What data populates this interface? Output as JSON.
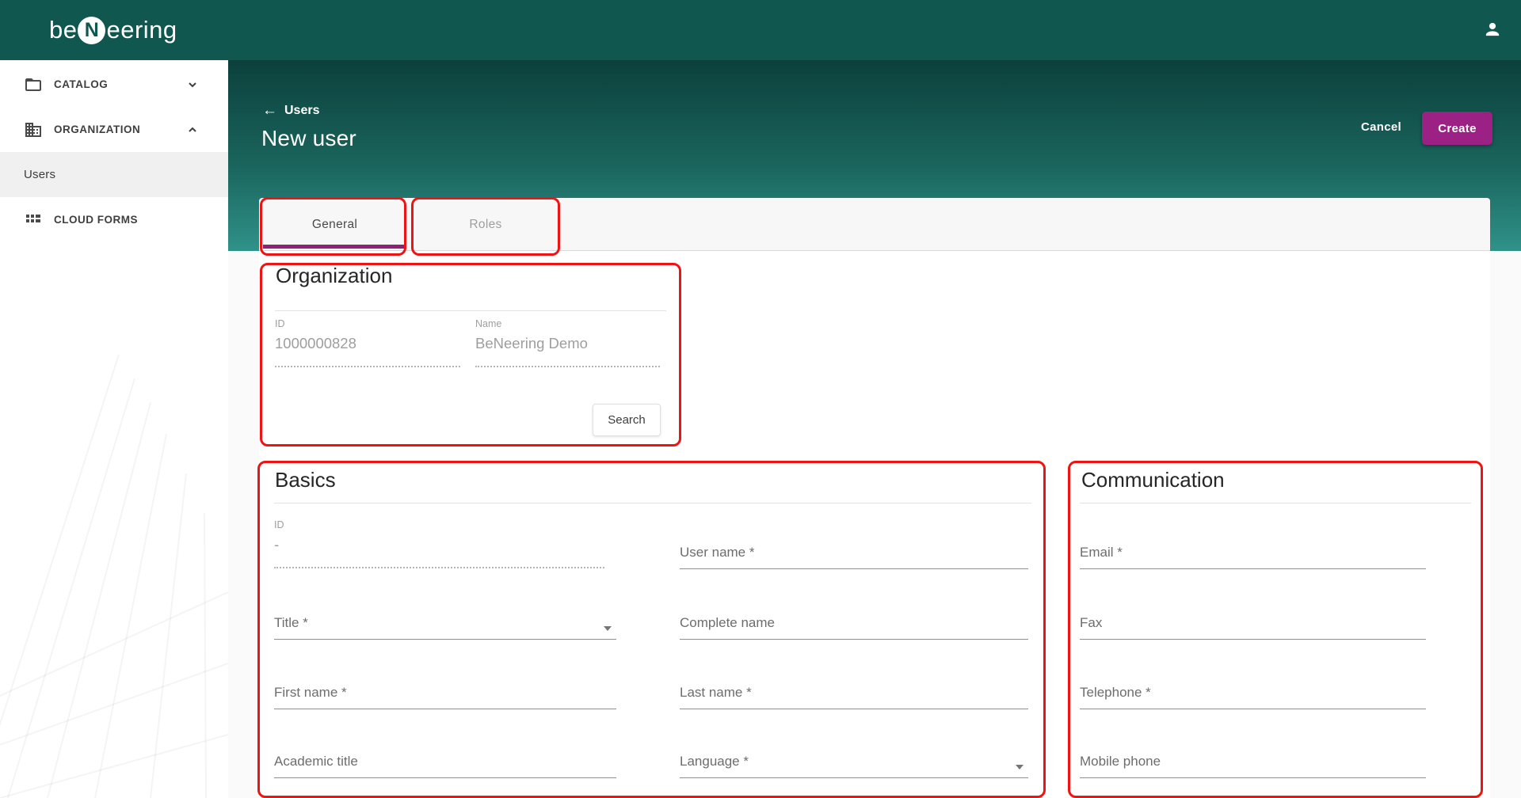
{
  "app_bar": {
    "logo_prefix": "be",
    "logo_n": "N",
    "logo_suffix": "eering"
  },
  "sidebar": {
    "catalog_label": "CATALOG",
    "organization_label": "ORGANIZATION",
    "users_label": "Users",
    "cloud_forms_label": "CLOUD FORMS"
  },
  "header": {
    "back_arrow": "←",
    "breadcrumb": "Users",
    "title": "New user",
    "cancel_label": "Cancel",
    "create_label": "Create"
  },
  "tabs": {
    "general": "General",
    "roles": "Roles"
  },
  "organization": {
    "title": "Organization",
    "id_label": "ID",
    "id_value": "1000000828",
    "name_label": "Name",
    "name_value": "BeNeering Demo",
    "search_label": "Search"
  },
  "basics": {
    "title": "Basics",
    "id_label": "ID",
    "id_value": "-",
    "user_name": "User name *",
    "title_field": "Title *",
    "complete_name": "Complete name",
    "first_name": "First name *",
    "last_name": "Last name *",
    "academic_title": "Academic title",
    "language": "Language *"
  },
  "communication": {
    "title": "Communication",
    "email": "Email *",
    "fax": "Fax",
    "telephone": "Telephone *",
    "mobile": "Mobile phone"
  },
  "colors": {
    "app_bar": "#0f574f",
    "header_gradient_top": "#0c403c",
    "header_gradient_bottom": "#2f9289",
    "create_button": "#9c2185",
    "tab_indicator": "#8e2178",
    "annotation_red": "#ee1414"
  }
}
